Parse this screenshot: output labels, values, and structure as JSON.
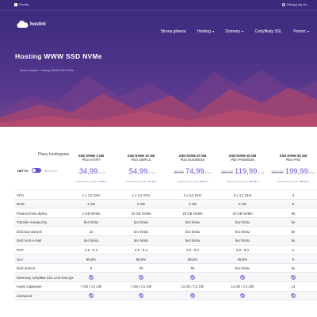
{
  "topbar": {
    "left_label": "Porzita",
    "right_label": "Zaloguj się do..."
  },
  "brand": {
    "name": "hostini"
  },
  "nav": {
    "items": [
      {
        "label": "Strona główna",
        "caret": false
      },
      {
        "label": "Hosting",
        "caret": true
      },
      {
        "label": "Domeny",
        "caret": true
      },
      {
        "label": "Certyfikaty SSL",
        "caret": false
      },
      {
        "label": "Pomoc",
        "caret": true
      }
    ]
  },
  "page": {
    "title": "Hosting WWW SSD NVMe",
    "breadcrumb": [
      "Strona Główna",
      "Hosting WWW SSD NVMe"
    ]
  },
  "toggle": {
    "netto": "NETTO",
    "brutto": "BRUTTO"
  },
  "plans_label": "Plany hostingowe",
  "plans": [
    {
      "name": "SSD NVMe 2 GB",
      "sub": "Plan START",
      "old": "",
      "price": "34,99",
      "unit": "zł / rok",
      "renew_label": "Odnowienie po roku:",
      "renew_value": "34,99 zł"
    },
    {
      "name": "SSD NVMe 10 GB",
      "sub": "Plan SIMPLE",
      "old": "",
      "price": "54,99",
      "unit": "zł / rok",
      "renew_label": "Odnowienie po roku:",
      "renew_value": "54,99 zł"
    },
    {
      "name": "SSD NVMe 20 GB",
      "sub": "Plan BUSINESS",
      "old": "89,99",
      "price": "74,99",
      "unit": "zł / rok",
      "renew_label": "Odnowienie po roku:",
      "renew_value": "89,99 zł"
    },
    {
      "name": "SSD NVMe 40 GB",
      "sub": "Plan PREMIUM",
      "old": "159,99",
      "price": "119,99",
      "unit": "zł / rok",
      "renew_label": "Odnowienie po roku:",
      "renew_value": "159,99 zł"
    },
    {
      "name": "SSD NVMe 80 GB",
      "sub": "Plan PRO",
      "old": "269,99",
      "price": "199,99",
      "unit": "zł / rok",
      "renew_label": "Odnowienie po roku:",
      "renew_value": "269,99 zł"
    }
  ],
  "rows": [
    {
      "label": "CPU",
      "values": [
        "1 x 3,2 GHz",
        "1 x 3,2 GHz",
        "2 x 3,2 GHz",
        "3 x 3,2 GHz",
        "4"
      ]
    },
    {
      "label": "RAM",
      "values": [
        "1 GB",
        "2 GB",
        "4 GB",
        "6 GB",
        "8"
      ]
    },
    {
      "label": "Powierzchnia dysku",
      "values": [
        "2 GB NVMe",
        "10 GB NVMe",
        "20 GB NVMe",
        "40 GB NVMe",
        "80"
      ]
    },
    {
      "label": "Transfer miesięczny",
      "values": [
        "bez limitu",
        "bez limitu",
        "bez limitu",
        "bez limitu",
        "be"
      ]
    },
    {
      "label": "Ilość baz danych",
      "values": [
        "10",
        "bez limitu",
        "bez limitu",
        "bez limitu",
        "be"
      ]
    },
    {
      "label": "Ilość kont e-mail",
      "values": [
        "bez limitu",
        "bez limitu",
        "bez limitu",
        "bez limitu",
        "be"
      ]
    },
    {
      "label": "PHP",
      "values": [
        "5.6 - 8.3",
        "5.6 - 8.3",
        "5.6 - 8.3",
        "5.6 - 8.3",
        "5."
      ]
    },
    {
      "label": "SLA",
      "values": [
        "99,9%",
        "99,9%",
        "99,9%",
        "99,9%",
        "9"
      ]
    },
    {
      "label": "Ilość domen",
      "values": [
        "5",
        "20",
        "50",
        "bez limitu",
        "be"
      ]
    },
    {
      "label": "Darmowy certyfikat SSL Let's Encrypt",
      "values": [
        "check",
        "check",
        "check",
        "check",
        "check"
      ]
    },
    {
      "label": "Kopie zapasowe",
      "values": [
        "7 dni / Co 24h",
        "7 dni / Co 24h",
        "14 dni / Co 24h",
        "14 dni / Co 24h",
        "14"
      ]
    },
    {
      "label": "LiteSpeed",
      "values": [
        "check",
        "check",
        "check",
        "check",
        "check"
      ]
    }
  ],
  "colors": {
    "hero": "#4a3288",
    "accent": "#6c4fd0"
  }
}
